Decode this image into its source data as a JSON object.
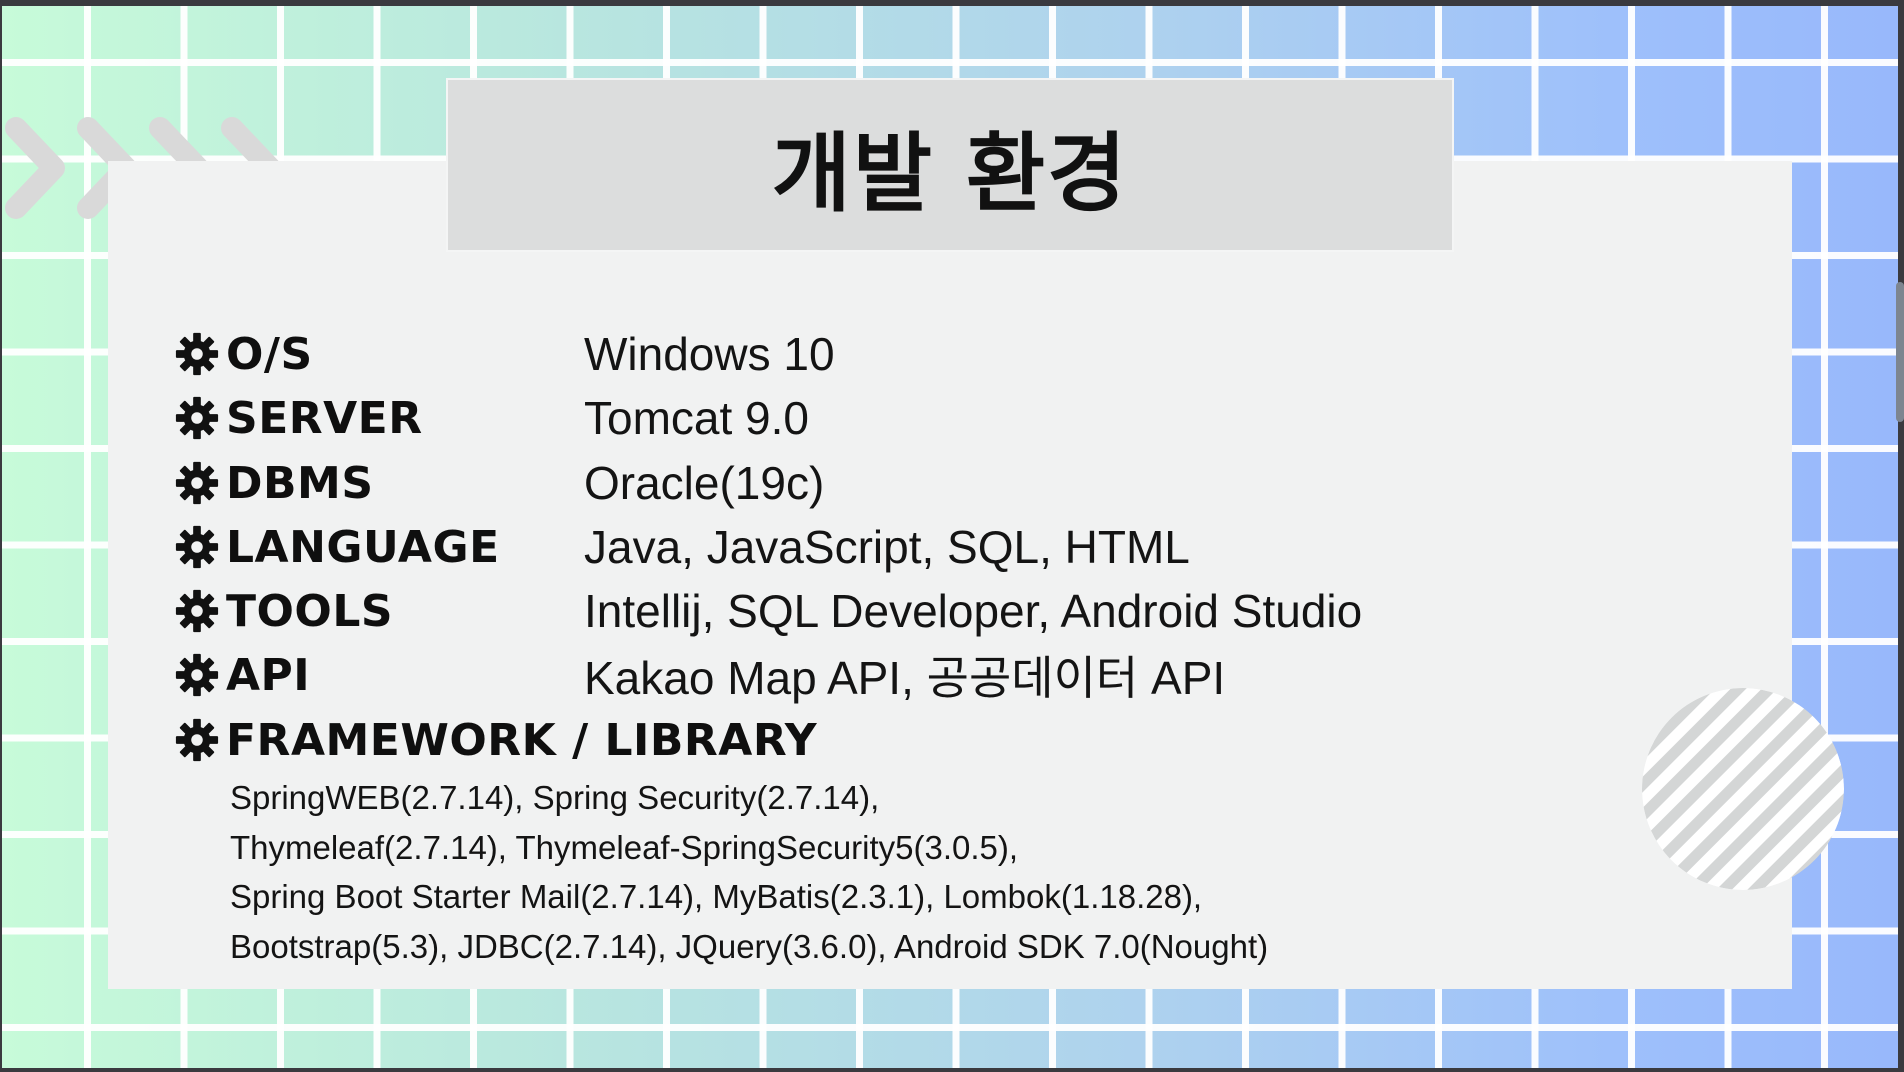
{
  "slide": {
    "title": "개발 환경",
    "rows": [
      {
        "label": "O/S",
        "value": "Windows 10",
        "icon": "gear-icon"
      },
      {
        "label": "SERVER",
        "value": "Tomcat 9.0",
        "icon": "gear-icon"
      },
      {
        "label": "DBMS",
        "value": "Oracle(19c)",
        "icon": "gear-icon"
      },
      {
        "label": "LANGUAGE",
        "value": "Java, JavaScript, SQL, HTML",
        "icon": "gear-icon"
      },
      {
        "label": "TOOLS",
        "value": "Intellij, SQL Developer, Android Studio",
        "icon": "gear-icon"
      },
      {
        "label": "API",
        "value": "Kakao Map API, 공공데이터 API",
        "icon": "gear-icon"
      }
    ],
    "framework": {
      "label": "FRAMEWORK / LIBRARY",
      "icon": "gear-icon",
      "lines": [
        "SpringWEB(2.7.14), Spring Security(2.7.14),",
        "Thymeleaf(2.7.14), Thymeleaf-SpringSecurity5(3.0.5),",
        "Spring Boot Starter Mail(2.7.14), MyBatis(2.3.1), Lombok(1.18.28),",
        "Bootstrap(5.3), JDBC(2.7.14), JQuery(3.6.0), Android SDK 7.0(Nought)"
      ]
    }
  },
  "colors": {
    "gradient_start": "#c7fbd9",
    "gradient_end": "#98b8fb",
    "card": "#f1f2f2",
    "title_box": "#dcdddd",
    "text": "#111111"
  }
}
